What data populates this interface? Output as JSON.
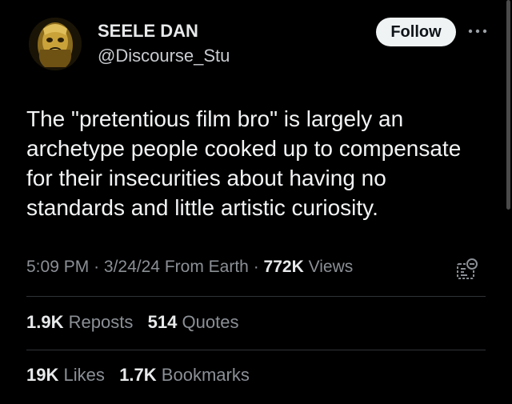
{
  "author": {
    "display_name": "SEELE DAN",
    "handle": "@Discourse_Stu",
    "avatar_icon": "gold-mask-avatar"
  },
  "actions": {
    "follow_label": "Follow",
    "more_icon": "more-horizontal-icon"
  },
  "post": {
    "text": "The \"pretentious film bro\" is largely an archetype people cooked up to compensate for their insecurities about having no standards and little artistic curiosity."
  },
  "meta": {
    "time": "5:09 PM",
    "date": "3/24/24",
    "location": "From Earth",
    "views_count": "772K",
    "views_label": "Views",
    "separator": "·"
  },
  "stats": {
    "reposts_count": "1.9K",
    "reposts_label": "Reposts",
    "quotes_count": "514",
    "quotes_label": "Quotes",
    "likes_count": "19K",
    "likes_label": "Likes",
    "bookmarks_count": "1.7K",
    "bookmarks_label": "Bookmarks"
  },
  "colors": {
    "background": "#000000",
    "text": "#e7e9ea",
    "muted": "#8b9096",
    "button_bg": "#eff3f4"
  }
}
